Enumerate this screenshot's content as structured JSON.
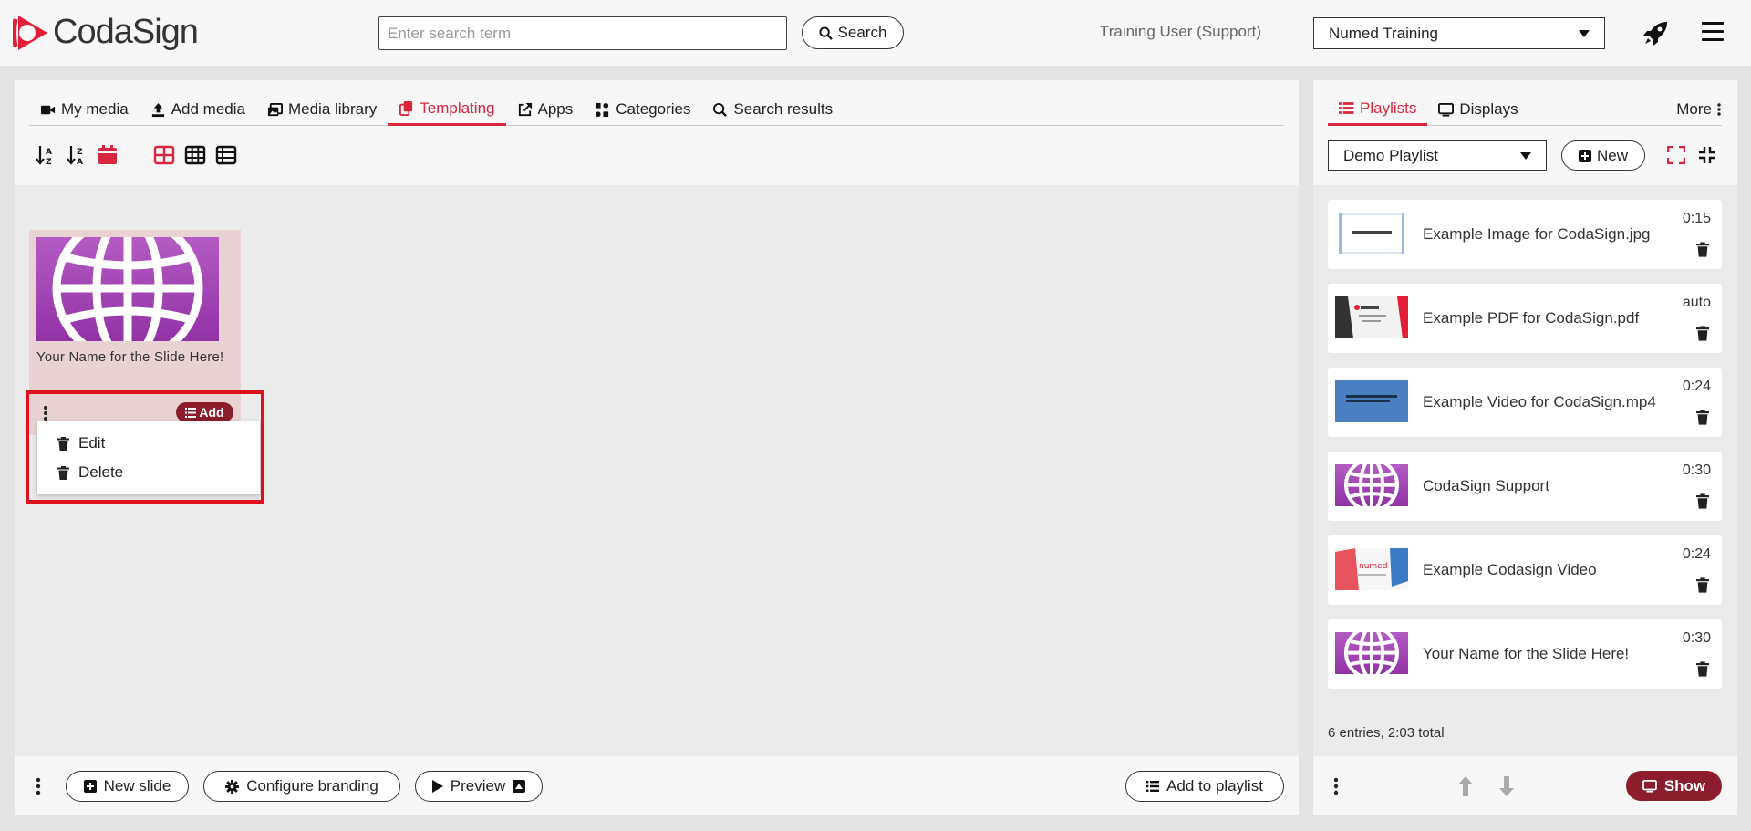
{
  "brand": {
    "name": "CodaSign",
    "accent": "#d7263d",
    "dark_red": "#8b1d2c"
  },
  "header": {
    "search_placeholder": "Enter search term",
    "search_button": "Search",
    "user_label": "Training User (Support)",
    "account": "Numed Training"
  },
  "tabs": [
    {
      "label": "My media",
      "icon": "video-icon"
    },
    {
      "label": "Add media",
      "icon": "upload-icon"
    },
    {
      "label": "Media library",
      "icon": "images-icon"
    },
    {
      "label": "Templating",
      "icon": "copy-icon",
      "active": true
    },
    {
      "label": "Apps",
      "icon": "external-link-icon"
    },
    {
      "label": "Categories",
      "icon": "categories-icon"
    },
    {
      "label": "Search results",
      "icon": "search-icon"
    }
  ],
  "card": {
    "title": "Your Name for the Slide Here!",
    "add_label": "Add",
    "menu": {
      "edit": "Edit",
      "delete": "Delete"
    }
  },
  "footer": {
    "new_slide": "New slide",
    "configure_branding": "Configure branding",
    "preview": "Preview",
    "add_to_playlist": "Add to playlist"
  },
  "right": {
    "tabs": [
      {
        "label": "Playlists",
        "icon": "list-icon",
        "active": true
      },
      {
        "label": "Displays",
        "icon": "monitor-icon"
      }
    ],
    "more": "More",
    "playlist": "Demo Playlist",
    "new_button": "New",
    "items": [
      {
        "name": "Example Image for CodaSign.jpg",
        "duration": "0:15",
        "thumb": "image"
      },
      {
        "name": "Example PDF for CodaSign.pdf",
        "duration": "auto",
        "thumb": "pdf"
      },
      {
        "name": "Example Video for CodaSign.mp4",
        "duration": "0:24",
        "thumb": "video"
      },
      {
        "name": "CodaSign Support",
        "duration": "0:30",
        "thumb": "globe"
      },
      {
        "name": "Example Codasign Video",
        "duration": "0:24",
        "thumb": "numed"
      },
      {
        "name": "Your Name for the Slide Here!",
        "duration": "0:30",
        "thumb": "globe"
      }
    ],
    "summary": "6 entries, 2:03 total",
    "show_button": "Show"
  }
}
